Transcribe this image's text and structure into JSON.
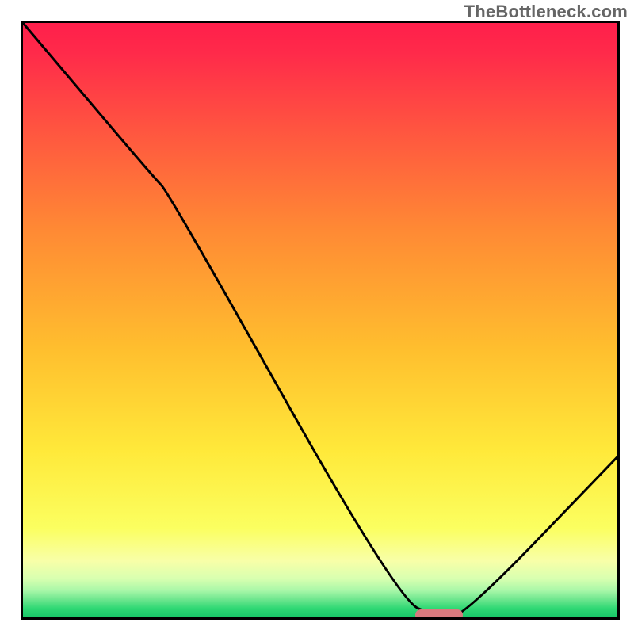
{
  "watermark": "TheBottleneck.com",
  "chart_data": {
    "type": "line",
    "title": "",
    "xlabel": "",
    "ylabel": "",
    "x_range": [
      0,
      100
    ],
    "y_range": [
      0,
      100
    ],
    "series": [
      {
        "name": "bottleneck-curve",
        "x": [
          0,
          22,
          24.5,
          63,
          70,
          74,
          100
        ],
        "y": [
          100,
          74,
          71.5,
          3,
          0,
          0,
          27
        ]
      }
    ],
    "optimum_marker": {
      "x_start": 66,
      "x_end": 74,
      "y": 0,
      "color": "#d87a7e"
    },
    "gradient_stops": [
      {
        "pos": 0.0,
        "color": "#ff1f4b"
      },
      {
        "pos": 0.05,
        "color": "#ff2a4a"
      },
      {
        "pos": 0.18,
        "color": "#ff5540"
      },
      {
        "pos": 0.35,
        "color": "#ff8a34"
      },
      {
        "pos": 0.55,
        "color": "#ffbf2e"
      },
      {
        "pos": 0.72,
        "color": "#ffe93a"
      },
      {
        "pos": 0.85,
        "color": "#fbff60"
      },
      {
        "pos": 0.905,
        "color": "#f8ffa8"
      },
      {
        "pos": 0.935,
        "color": "#d8ffb0"
      },
      {
        "pos": 0.955,
        "color": "#a8f7a8"
      },
      {
        "pos": 0.97,
        "color": "#6de68e"
      },
      {
        "pos": 0.985,
        "color": "#2fd874"
      },
      {
        "pos": 1.0,
        "color": "#18c768"
      }
    ]
  },
  "colors": {
    "curve": "#000000",
    "border": "#000000"
  }
}
